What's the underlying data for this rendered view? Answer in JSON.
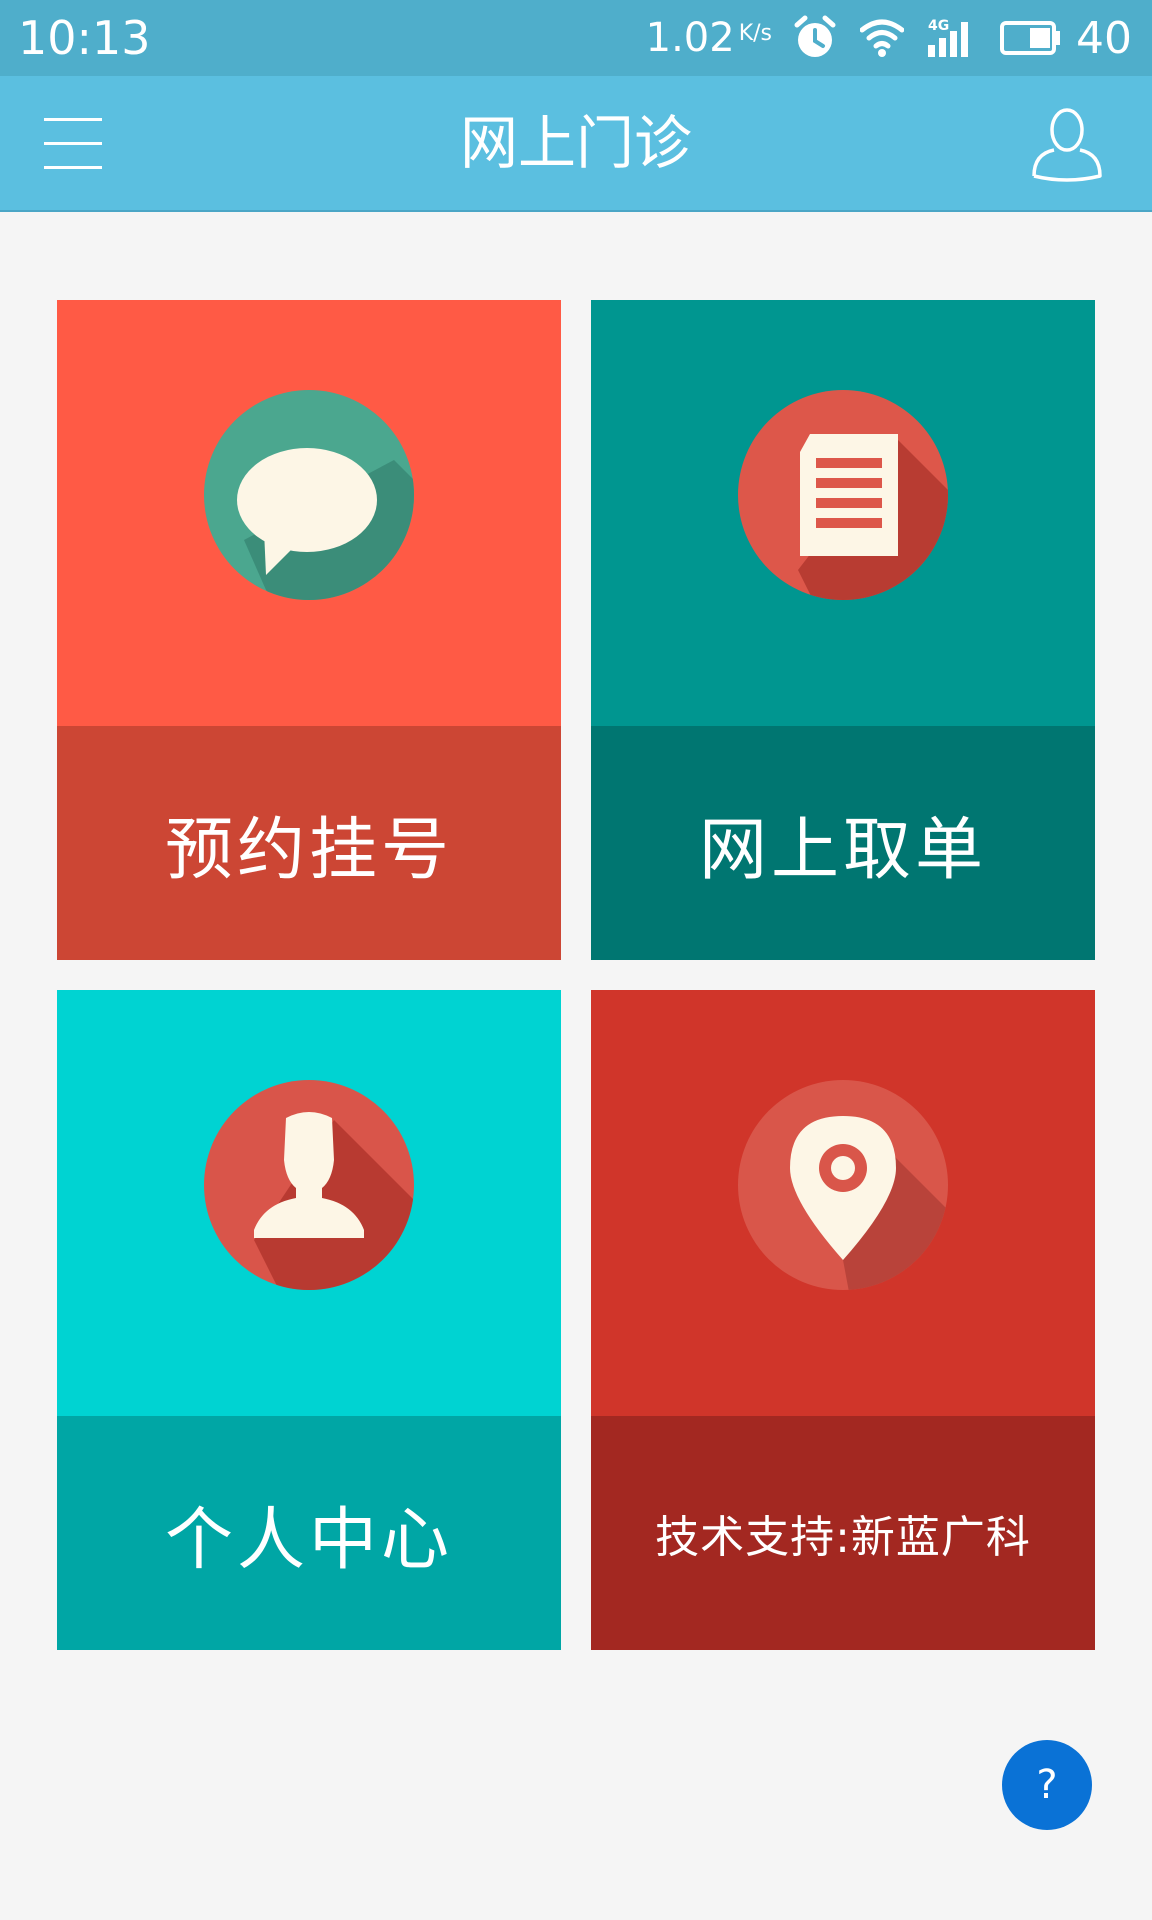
{
  "status_bar": {
    "time": "10:13",
    "net_speed": "1.02",
    "net_speed_unit": "K/s",
    "network_label": "4G",
    "battery": "40",
    "icons": [
      "alarm-icon",
      "wifi-icon",
      "signal-4g-icon",
      "battery-icon"
    ]
  },
  "app_bar": {
    "title": "网上门诊",
    "menu_icon": "menu-icon",
    "user_icon": "user-icon"
  },
  "tiles": [
    {
      "label": "预约挂号",
      "icon": "chat-bubble-icon",
      "top_color": "#ff5a45",
      "bottom_color": "#cc4634",
      "circle_color": "#4ba78f"
    },
    {
      "label": "网上取单",
      "icon": "document-icon",
      "top_color": "#009690",
      "bottom_color": "#007671",
      "circle_color": "#dd574a"
    },
    {
      "label": "个人中心",
      "icon": "person-icon",
      "top_color": "#00d3d2",
      "bottom_color": "#00a6a5",
      "circle_color": "#d9554a"
    },
    {
      "label": "技术支持:新蓝广科",
      "icon": "location-pin-icon",
      "top_color": "#d0352a",
      "bottom_color": "#a32821",
      "circle_color": "#d9564a"
    }
  ],
  "help_button": {
    "label": "?",
    "color": "#0a72d6"
  },
  "colors": {
    "status_bar": "#4faecb",
    "app_bar": "#5bbfe0",
    "background": "#f5f5f5",
    "icon_foreground": "#fdf6e6"
  }
}
